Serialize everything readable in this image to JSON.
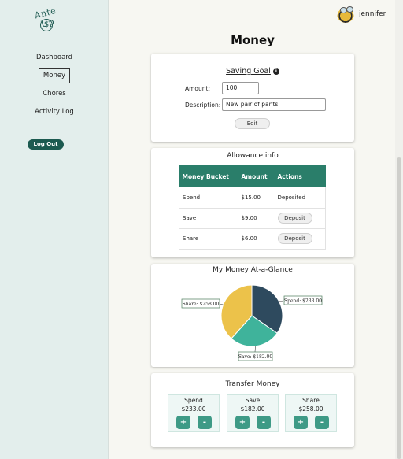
{
  "logo": {
    "text": "Ante Up",
    "coin_symbol": "$"
  },
  "sidebar": {
    "items": [
      {
        "label": "Dashboard"
      },
      {
        "label": "Money"
      },
      {
        "label": "Chores"
      },
      {
        "label": "Activity Log"
      }
    ],
    "active": "Money",
    "logout_label": "Log Out"
  },
  "user": {
    "name": "jennifer",
    "avatar_icon": "bee-icon"
  },
  "page": {
    "title": "Money"
  },
  "saving_goal": {
    "title": "Saving Goal",
    "info_icon": "i",
    "amount_label": "Amount:",
    "amount_value": "100",
    "description_label": "Description:",
    "description_value": "New pair of pants",
    "edit_label": "Edit"
  },
  "allowance": {
    "title": "Allowance info",
    "columns": [
      "Money Bucket",
      "Amount",
      "Actions"
    ],
    "rows": [
      {
        "bucket": "Spend",
        "amount": "$15.00",
        "action": "Deposited",
        "is_button": false
      },
      {
        "bucket": "Save",
        "amount": "$9.00",
        "action": "Deposit",
        "is_button": true
      },
      {
        "bucket": "Share",
        "amount": "$6.00",
        "action": "Deposit",
        "is_button": true
      }
    ]
  },
  "glance": {
    "title": "My Money At-a-Glance",
    "chart_data": {
      "type": "pie",
      "slices": [
        {
          "name": "Spend",
          "value": 233,
          "label": "Spend: $233.00",
          "color": "#2e4a5e"
        },
        {
          "name": "Save",
          "value": 182,
          "label": "Save: $182.00",
          "color": "#3fb39b"
        },
        {
          "name": "Share",
          "value": 258,
          "label": "Share: $258.00",
          "color": "#ecc24a"
        }
      ]
    }
  },
  "transfer": {
    "title": "Transfer Money",
    "buckets": [
      {
        "name": "Spend",
        "amount": "$233.00"
      },
      {
        "name": "Save",
        "amount": "$182.00"
      },
      {
        "name": "Share",
        "amount": "$258.00"
      }
    ],
    "plus_label": "+",
    "minus_label": "-"
  },
  "colors": {
    "accent": "#1c5a50",
    "table_header": "#2a7e6a",
    "transfer_button": "#3e9a86",
    "sidebar_bg": "#e3eeec"
  }
}
